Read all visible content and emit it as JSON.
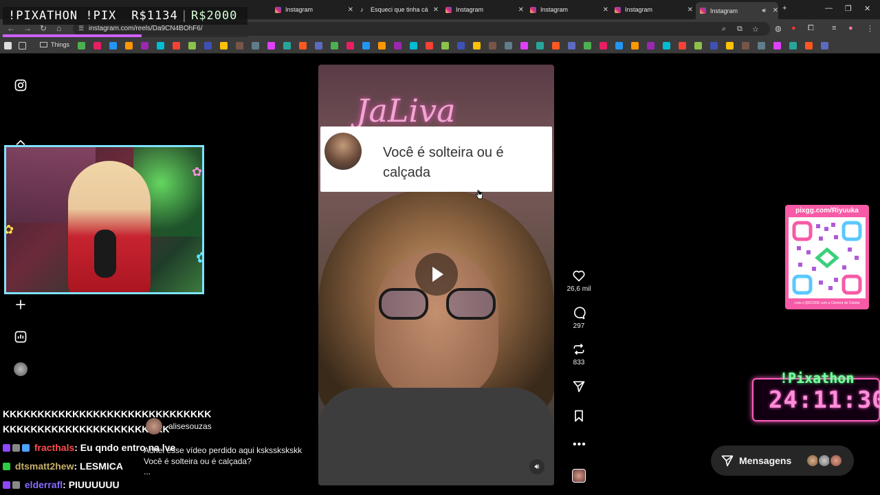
{
  "browser": {
    "tabs": [
      {
        "title": "Instagram",
        "icon": "instagram-icon"
      },
      {
        "title": "Esqueci que tinha cá",
        "icon": "tiktok-icon"
      },
      {
        "title": "Instagram",
        "icon": "instagram-icon"
      },
      {
        "title": "Instagram",
        "icon": "instagram-icon"
      },
      {
        "title": "Instagram",
        "icon": "instagram-icon"
      },
      {
        "title": "Instagram",
        "icon": "instagram-icon",
        "active": true
      }
    ],
    "new_tab": "+",
    "url": "instagram.com/reels/Da9CN4BOhF6/",
    "bookmark_folder": "Things"
  },
  "overlay": {
    "pixathon_banner": {
      "label": "!PIXATHON !PIX",
      "amount": "R$1134",
      "goal": "R$2000"
    },
    "progress": 0.567,
    "timer": {
      "title": "!Pixathon",
      "time": "24:11:30"
    },
    "qr": {
      "url": "pixgg.com/Riyuuka",
      "footer": "Leia o QRCODE com a Câmera do Celular"
    }
  },
  "chat": [
    {
      "user": "",
      "message": "KKKKKKKKKKKKKKKKKKKKKKKKKKKKKK",
      "user_color": "#ffffff"
    },
    {
      "user": "",
      "message": "KKKKKKKKKKKKKKKKKKKKKKKK",
      "user_color": "#ffffff"
    },
    {
      "user": "fracthals",
      "message": ": Eu qndo entro na lve",
      "user_color": "#ff4d4d"
    },
    {
      "user": "dtsmatt2hew",
      "message": ": LESMICA",
      "user_color": "#c8b06a"
    },
    {
      "user": "elderrafl",
      "message": ": PIUUUUUU",
      "user_color": "#8a6cff"
    }
  ],
  "reel": {
    "neon_text": "JaLiva",
    "question": "Você é solteira ou é calçada",
    "likes": "26,6 mil",
    "comments": "297",
    "reposts": "833",
    "author": "alisesouzas",
    "caption_line1": "Achei esse vídeo perdido aqui ksksskskskk",
    "caption_line2": "Você é solteira ou é calçada?",
    "caption_more": "..."
  },
  "messages": {
    "label": "Mensagens"
  },
  "colors": {
    "accent_pink": "#ff5cc0",
    "timer_green": "#7dffa2",
    "webcam_border": "#7fe3ff"
  }
}
